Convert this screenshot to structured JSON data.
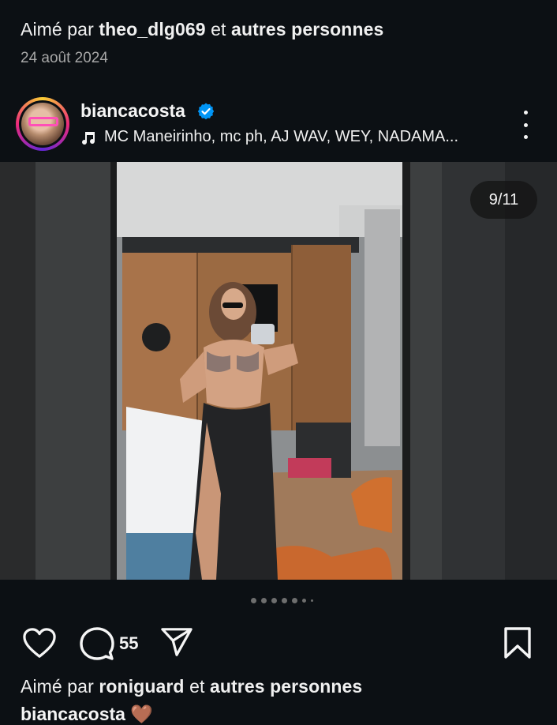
{
  "prev_post": {
    "liked_prefix": "Aimé par",
    "liked_user": "theo_dlg069",
    "liked_mid": "et",
    "liked_suffix": "autres personnes",
    "date": "24 août 2024"
  },
  "post": {
    "username": "biancacosta",
    "verified": true,
    "music": "MC Maneirinho, mc ph, AJ WAV, WEY, NADAMA...",
    "carousel_counter": "9/11",
    "carousel_dots": 7,
    "active_dot_index": 8,
    "comment_count": "55",
    "liked_prefix": "Aimé par",
    "liked_user": "roniguard",
    "liked_mid": "et",
    "liked_suffix": "autres personnes",
    "caption_user": "biancacosta",
    "caption_emoji": "🤎"
  },
  "icons": {
    "like": "heart-icon",
    "comment": "comment-icon",
    "share": "send-icon",
    "save": "bookmark-icon",
    "more": "more-vertical-icon",
    "music": "music-note-icon",
    "verified": "verified-badge-icon"
  },
  "colors": {
    "background": "#0c1014",
    "text": "#f5f5f5",
    "muted": "#a8a8a8",
    "verified": "#0095f6",
    "story_ring_start": "#f9ce34",
    "story_ring_end": "#ee2a7b"
  }
}
